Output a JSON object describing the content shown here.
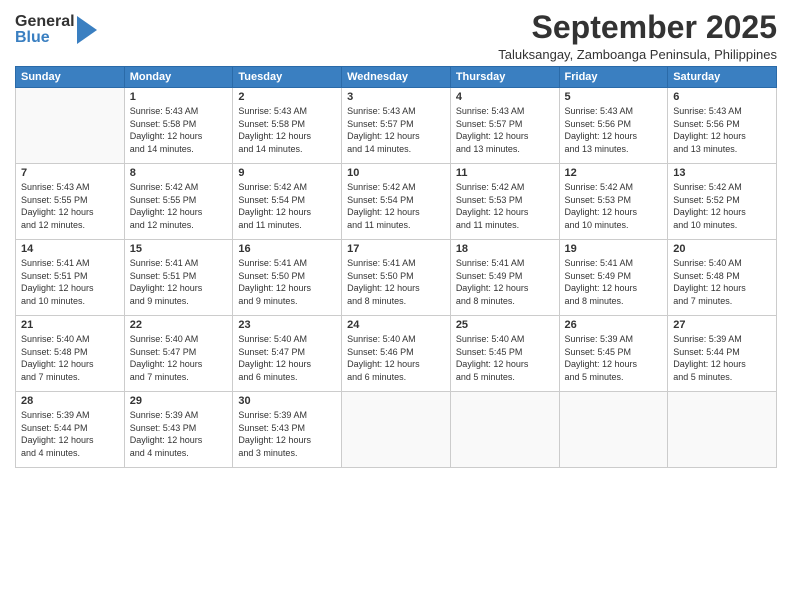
{
  "logo": {
    "general": "General",
    "blue": "Blue"
  },
  "title": "September 2025",
  "subtitle": "Taluksangay, Zamboanga Peninsula, Philippines",
  "days_of_week": [
    "Sunday",
    "Monday",
    "Tuesday",
    "Wednesday",
    "Thursday",
    "Friday",
    "Saturday"
  ],
  "weeks": [
    [
      {
        "day": "",
        "info": ""
      },
      {
        "day": "1",
        "info": "Sunrise: 5:43 AM\nSunset: 5:58 PM\nDaylight: 12 hours\nand 14 minutes."
      },
      {
        "day": "2",
        "info": "Sunrise: 5:43 AM\nSunset: 5:58 PM\nDaylight: 12 hours\nand 14 minutes."
      },
      {
        "day": "3",
        "info": "Sunrise: 5:43 AM\nSunset: 5:57 PM\nDaylight: 12 hours\nand 14 minutes."
      },
      {
        "day": "4",
        "info": "Sunrise: 5:43 AM\nSunset: 5:57 PM\nDaylight: 12 hours\nand 13 minutes."
      },
      {
        "day": "5",
        "info": "Sunrise: 5:43 AM\nSunset: 5:56 PM\nDaylight: 12 hours\nand 13 minutes."
      },
      {
        "day": "6",
        "info": "Sunrise: 5:43 AM\nSunset: 5:56 PM\nDaylight: 12 hours\nand 13 minutes."
      }
    ],
    [
      {
        "day": "7",
        "info": "Sunrise: 5:43 AM\nSunset: 5:55 PM\nDaylight: 12 hours\nand 12 minutes."
      },
      {
        "day": "8",
        "info": "Sunrise: 5:42 AM\nSunset: 5:55 PM\nDaylight: 12 hours\nand 12 minutes."
      },
      {
        "day": "9",
        "info": "Sunrise: 5:42 AM\nSunset: 5:54 PM\nDaylight: 12 hours\nand 11 minutes."
      },
      {
        "day": "10",
        "info": "Sunrise: 5:42 AM\nSunset: 5:54 PM\nDaylight: 12 hours\nand 11 minutes."
      },
      {
        "day": "11",
        "info": "Sunrise: 5:42 AM\nSunset: 5:53 PM\nDaylight: 12 hours\nand 11 minutes."
      },
      {
        "day": "12",
        "info": "Sunrise: 5:42 AM\nSunset: 5:53 PM\nDaylight: 12 hours\nand 10 minutes."
      },
      {
        "day": "13",
        "info": "Sunrise: 5:42 AM\nSunset: 5:52 PM\nDaylight: 12 hours\nand 10 minutes."
      }
    ],
    [
      {
        "day": "14",
        "info": "Sunrise: 5:41 AM\nSunset: 5:51 PM\nDaylight: 12 hours\nand 10 minutes."
      },
      {
        "day": "15",
        "info": "Sunrise: 5:41 AM\nSunset: 5:51 PM\nDaylight: 12 hours\nand 9 minutes."
      },
      {
        "day": "16",
        "info": "Sunrise: 5:41 AM\nSunset: 5:50 PM\nDaylight: 12 hours\nand 9 minutes."
      },
      {
        "day": "17",
        "info": "Sunrise: 5:41 AM\nSunset: 5:50 PM\nDaylight: 12 hours\nand 8 minutes."
      },
      {
        "day": "18",
        "info": "Sunrise: 5:41 AM\nSunset: 5:49 PM\nDaylight: 12 hours\nand 8 minutes."
      },
      {
        "day": "19",
        "info": "Sunrise: 5:41 AM\nSunset: 5:49 PM\nDaylight: 12 hours\nand 8 minutes."
      },
      {
        "day": "20",
        "info": "Sunrise: 5:40 AM\nSunset: 5:48 PM\nDaylight: 12 hours\nand 7 minutes."
      }
    ],
    [
      {
        "day": "21",
        "info": "Sunrise: 5:40 AM\nSunset: 5:48 PM\nDaylight: 12 hours\nand 7 minutes."
      },
      {
        "day": "22",
        "info": "Sunrise: 5:40 AM\nSunset: 5:47 PM\nDaylight: 12 hours\nand 7 minutes."
      },
      {
        "day": "23",
        "info": "Sunrise: 5:40 AM\nSunset: 5:47 PM\nDaylight: 12 hours\nand 6 minutes."
      },
      {
        "day": "24",
        "info": "Sunrise: 5:40 AM\nSunset: 5:46 PM\nDaylight: 12 hours\nand 6 minutes."
      },
      {
        "day": "25",
        "info": "Sunrise: 5:40 AM\nSunset: 5:45 PM\nDaylight: 12 hours\nand 5 minutes."
      },
      {
        "day": "26",
        "info": "Sunrise: 5:39 AM\nSunset: 5:45 PM\nDaylight: 12 hours\nand 5 minutes."
      },
      {
        "day": "27",
        "info": "Sunrise: 5:39 AM\nSunset: 5:44 PM\nDaylight: 12 hours\nand 5 minutes."
      }
    ],
    [
      {
        "day": "28",
        "info": "Sunrise: 5:39 AM\nSunset: 5:44 PM\nDaylight: 12 hours\nand 4 minutes."
      },
      {
        "day": "29",
        "info": "Sunrise: 5:39 AM\nSunset: 5:43 PM\nDaylight: 12 hours\nand 4 minutes."
      },
      {
        "day": "30",
        "info": "Sunrise: 5:39 AM\nSunset: 5:43 PM\nDaylight: 12 hours\nand 3 minutes."
      },
      {
        "day": "",
        "info": ""
      },
      {
        "day": "",
        "info": ""
      },
      {
        "day": "",
        "info": ""
      },
      {
        "day": "",
        "info": ""
      }
    ]
  ]
}
